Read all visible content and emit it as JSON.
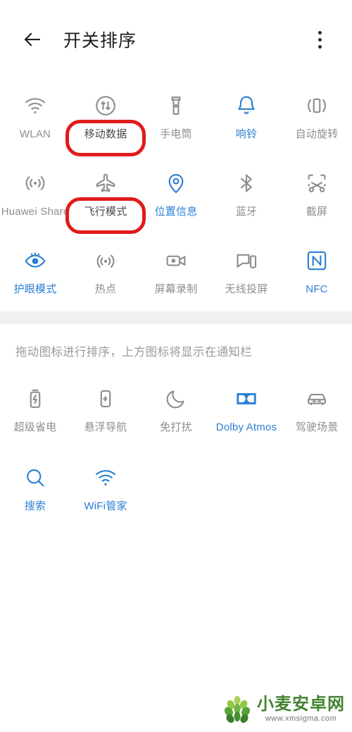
{
  "header": {
    "title": "开关排序",
    "back_icon": "arrow-left-icon",
    "more_icon": "more-vertical-icon"
  },
  "hint": "拖动图标进行排序，上方图标将显示在通知栏",
  "colors": {
    "accent_blue": "#2a7fd4",
    "inactive_gray": "#8e8e8e",
    "highlight_red": "#e01b1b",
    "background": "#ffffff",
    "band_gray": "#f1f1f1"
  },
  "top_panel": {
    "tiles": [
      {
        "label": "WLAN",
        "icon": "wifi-icon",
        "state": "off",
        "highlighted": false
      },
      {
        "label": "移动数据",
        "icon": "mobile-data-icon",
        "state": "off",
        "highlighted": true
      },
      {
        "label": "手电筒",
        "icon": "flashlight-icon",
        "state": "off",
        "highlighted": false
      },
      {
        "label": "响铃",
        "icon": "bell-icon",
        "state": "on",
        "highlighted": false
      },
      {
        "label": "自动旋转",
        "icon": "auto-rotate-icon",
        "state": "off",
        "highlighted": false
      },
      {
        "label": "Huawei Share",
        "icon": "huawei-share-icon",
        "state": "off",
        "highlighted": false
      },
      {
        "label": "飞行模式",
        "icon": "airplane-icon",
        "state": "off",
        "highlighted": true
      },
      {
        "label": "位置信息",
        "icon": "location-pin-icon",
        "state": "on",
        "highlighted": false
      },
      {
        "label": "蓝牙",
        "icon": "bluetooth-icon",
        "state": "off",
        "highlighted": false
      },
      {
        "label": "截屏",
        "icon": "screenshot-icon",
        "state": "off",
        "highlighted": false
      },
      {
        "label": "护眼模式",
        "icon": "eye-comfort-icon",
        "state": "on",
        "highlighted": false
      },
      {
        "label": "热点",
        "icon": "hotspot-icon",
        "state": "off",
        "highlighted": false
      },
      {
        "label": "屏幕录制",
        "icon": "screen-record-icon",
        "state": "off",
        "highlighted": false
      },
      {
        "label": "无线投屏",
        "icon": "cast-screen-icon",
        "state": "off",
        "highlighted": false
      },
      {
        "label": "NFC",
        "icon": "nfc-icon",
        "state": "on",
        "highlighted": false
      }
    ]
  },
  "bottom_panel": {
    "tiles": [
      {
        "label": "超级省电",
        "icon": "battery-saver-icon",
        "state": "off"
      },
      {
        "label": "悬浮导航",
        "icon": "floating-nav-icon",
        "state": "off"
      },
      {
        "label": "免打扰",
        "icon": "moon-icon",
        "state": "off"
      },
      {
        "label": "Dolby Atmos",
        "icon": "dolby-icon",
        "state": "on"
      },
      {
        "label": "驾驶场景",
        "icon": "car-icon",
        "state": "off"
      },
      {
        "label": "搜索",
        "icon": "search-icon",
        "state": "on"
      },
      {
        "label": "WiFi管家",
        "icon": "wifi-manager-icon",
        "state": "on"
      }
    ]
  },
  "watermark": {
    "name": "小麦安卓网",
    "url": "www.xmsigma.com"
  }
}
